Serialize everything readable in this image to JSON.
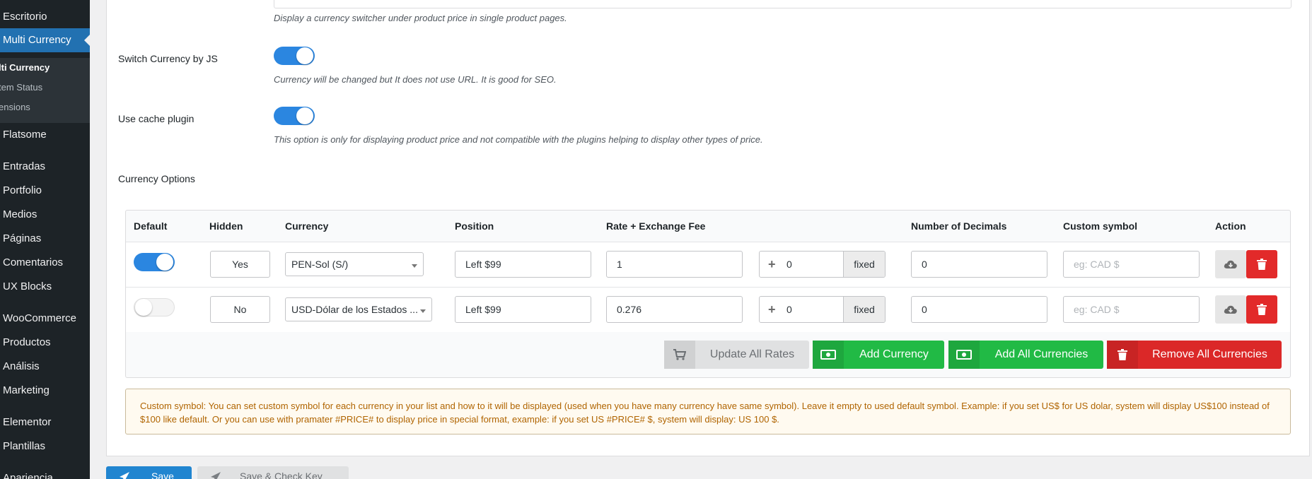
{
  "sidebar": {
    "items": [
      {
        "label": "Escritorio"
      },
      {
        "label": "Multi Currency"
      },
      {
        "label": "Flatsome"
      },
      {
        "label": "Entradas"
      },
      {
        "label": "Portfolio"
      },
      {
        "label": "Medios"
      },
      {
        "label": "Páginas"
      },
      {
        "label": "Comentarios"
      },
      {
        "label": "UX Blocks"
      },
      {
        "label": "WooCommerce"
      },
      {
        "label": "Productos"
      },
      {
        "label": "Análisis"
      },
      {
        "label": "Marketing"
      },
      {
        "label": "Elementor"
      },
      {
        "label": "Plantillas"
      },
      {
        "label": "Apariencia"
      }
    ],
    "submenu": [
      {
        "label": "lti Currency"
      },
      {
        "label": "tem Status"
      },
      {
        "label": "ensions"
      }
    ]
  },
  "settings": {
    "switcher_desc": "Display a currency switcher under product price in single product pages.",
    "switch_js": {
      "label": "Switch Currency by JS",
      "desc": "Currency will be changed but It does not use URL. It is good for SEO.",
      "enabled": true
    },
    "cache": {
      "label": "Use cache plugin",
      "desc": "This option is only for displaying product price and not compatible with the plugins helping to display other types of price.",
      "enabled": true
    },
    "currency_options_label": "Currency Options"
  },
  "table": {
    "headers": {
      "default": "Default",
      "hidden": "Hidden",
      "currency": "Currency",
      "position": "Position",
      "rate": "Rate + Exchange Fee",
      "decimals": "Number of Decimals",
      "custom_symbol": "Custom symbol",
      "action": "Action"
    },
    "rows": [
      {
        "default": true,
        "hidden": "Yes",
        "currency": "PEN-Sol (S/)",
        "position": "Left $99",
        "rate": "1",
        "fee": "0",
        "fee_type": "fixed",
        "decimals": "0",
        "custom_symbol_placeholder": "eg: CAD $"
      },
      {
        "default": false,
        "hidden": "No",
        "currency": "USD-Dólar de los Estados ...",
        "position": "Left $99",
        "rate": "0.276",
        "fee": "0",
        "fee_type": "fixed",
        "decimals": "0",
        "custom_symbol_placeholder": "eg: CAD $"
      }
    ],
    "buttons": {
      "update_rates": "Update All Rates",
      "add_currency": "Add Currency",
      "add_all": "Add All Currencies",
      "remove_all": "Remove All Currencies"
    }
  },
  "notice": {
    "text": "Custom symbol: You can set custom symbol for each currency in your list and how to it will be displayed (used when you have many currency have same symbol). Leave it empty to used default symbol. Example: if you set US$ for US dolar, system will display US$100 instead of $100 like default. Or you can use with pramater #PRICE# to display price in special format, example: if you set US #PRICE# $, system will display: US 100 $."
  },
  "footer": {
    "save": "Save",
    "save_check": "Save & Check Key"
  },
  "colors": {
    "sidebar_bg": "#1d2327",
    "accent": "#2271b1",
    "toggle_on": "#2b86e0",
    "green": "#21ba45",
    "red": "#db2828"
  }
}
